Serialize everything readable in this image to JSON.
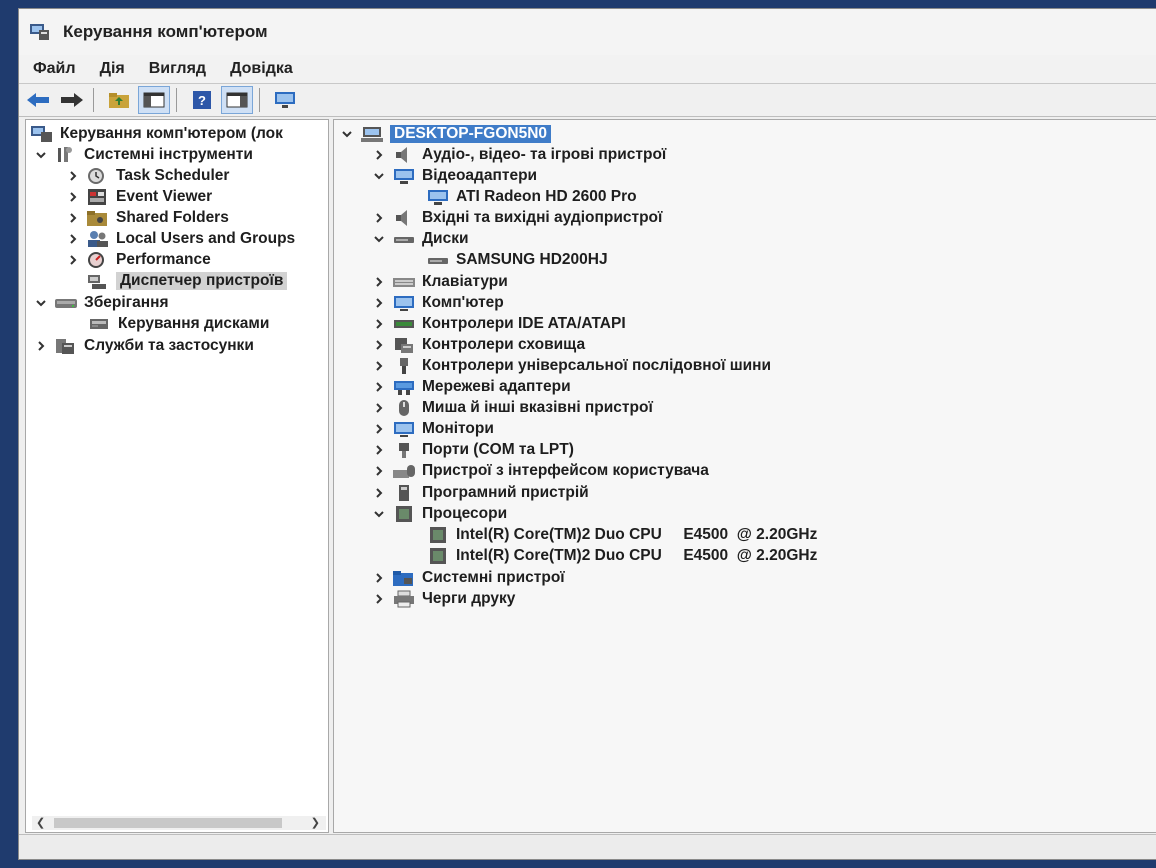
{
  "window": {
    "title": "Керування комп'ютером"
  },
  "menu": [
    "Файл",
    "Дія",
    "Вигляд",
    "Довідка"
  ],
  "toolbar": {
    "buttons": [
      "back-icon",
      "forward-icon",
      "up-folder-icon",
      "show-hide-console-tree-icon",
      "help-icon",
      "show-hide-action-pane-icon",
      "monitor-icon"
    ]
  },
  "left_tree": {
    "root": "Керування комп'ютером (лок",
    "system_tools": "Системні інструменти",
    "task_scheduler": "Task Scheduler",
    "event_viewer": "Event Viewer",
    "shared_folders": "Shared Folders",
    "local_users": "Local Users and Groups",
    "performance": "Performance",
    "device_manager": "Диспетчер пристроїв",
    "storage": "Зберігання",
    "disk_management": "Керування дисками",
    "services": "Служби та застосунки"
  },
  "device_tree": {
    "computer_name": "DESKTOP-FGON5N0",
    "audio_video": "Аудіо-, відео- та ігрові пристрої",
    "display_adapters": "Відеоадаптери",
    "gpu": "ATI Radeon HD 2600 Pro",
    "audio_io": "Вхідні та вихідні аудіопристрої",
    "disks": "Диски",
    "disk0": "SAMSUNG HD200HJ",
    "keyboards": "Клавіатури",
    "computer": "Комп'ютер",
    "ide": "Контролери IDE ATA/ATAPI",
    "storage_ctrl": "Контролери сховища",
    "usb": "Контролери універсальної послідовної шини",
    "network": "Мережеві адаптери",
    "mice": "Миша й інші вказівні пристрої",
    "monitors": "Монітори",
    "ports": "Порти (COM та LPT)",
    "hid": "Пристрої з інтерфейсом користувача",
    "software": "Програмний пристрій",
    "processors": "Процесори",
    "cpu0": "Intel(R) Core(TM)2 Duo CPU     E4500  @ 2.20GHz",
    "cpu1": "Intel(R) Core(TM)2 Duo CPU     E4500  @ 2.20GHz",
    "system_devices": "Системні пристрої",
    "print_queues": "Черги друку"
  },
  "colors": {
    "selection": "#3f7cc8",
    "accent_blue": "#2d6cc0"
  }
}
